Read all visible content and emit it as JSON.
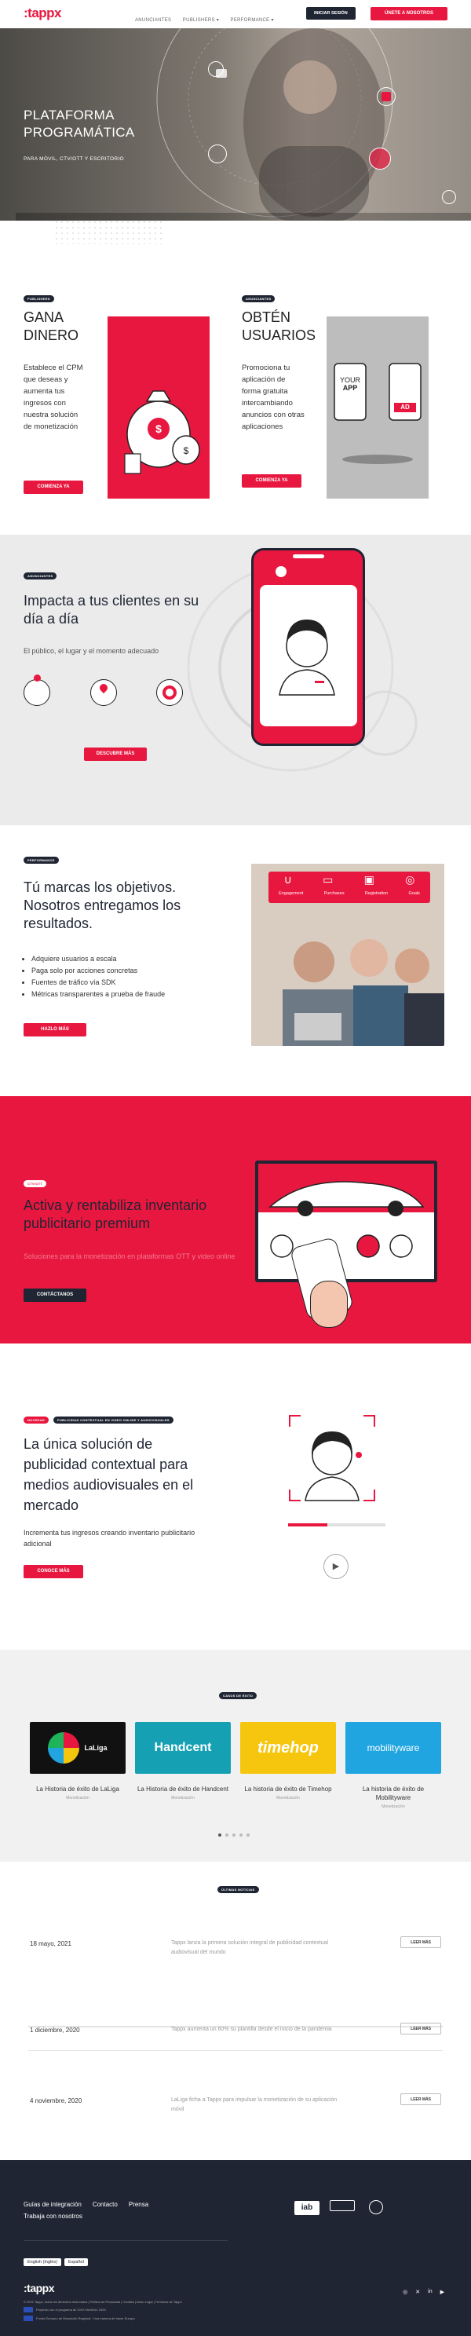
{
  "header": {
    "logo": ":tappx",
    "nav": [
      "ANUNCIANTES",
      "PUBLISHERS ▾",
      "PERFORMANCE ▾"
    ],
    "login": "INICIAR SESIÓN",
    "signup": "ÚNETE A NOSOTROS"
  },
  "hero": {
    "title": "PLATAFORMA PROGRAMÁTICA",
    "subtitle": "PARA MÓVIL, CTV/OTT Y ESCRITORIO"
  },
  "cards": [
    {
      "tag": "PUBLISHERS",
      "title": "GANA DINERO",
      "text": "Establece el CPM que deseas y aumenta tus ingresos con nuestra solución de monetización",
      "button": "COMIENZA YA"
    },
    {
      "tag": "ANUNCIANTES",
      "title": "OBTÉN USUARIOS",
      "text": "Promociona tu aplicación de forma gratuita intercambiando anuncios con otras aplicaciones",
      "button": "COMIENZA YA",
      "phone_label1": "YOUR",
      "phone_label2": "APP",
      "phone_ad": "AD"
    }
  ],
  "impact": {
    "tag": "ANUNCIANTES",
    "title": "Impacta a tus clientes en su día a día",
    "subtitle": "El público, el lugar y el momento adecuado",
    "button": "DESCUBRE MÁS"
  },
  "marks": {
    "tag": "PERFORMANCE",
    "title": "Tú marcas los objetivos. Nosotros entregamos los resultados.",
    "bullets": [
      "Adquiere usuarios a escala",
      "Paga solo por acciones concretas",
      "Fuentes de tráfico vía SDK",
      "Métricas transparentes a prueba de fraude"
    ],
    "button": "HAZLO MÁS",
    "icons": [
      "Engagement",
      "Purchases",
      "Registration",
      "Goals"
    ]
  },
  "ctv": {
    "tag": "CTV/OTT",
    "title": "Activa y rentabiliza inventario publicitario premium",
    "subtitle": "Soluciones para la monetización en plataformas OTT y video online",
    "button": "CONTÁCTANOS"
  },
  "context": {
    "tags": [
      "NOVEDAD",
      "PUBLICIDAD CONTEXTUAL EN VIDEO ONLINE Y AUDIOVISUALES"
    ],
    "title": "La única solución de publicidad contextual para medios audiovisuales en el mercado",
    "subtitle": "Incrementa tus ingresos creando inventario publicitario adicional",
    "button": "CONOCE MÁS"
  },
  "cases": {
    "tag": "CASOS DE ÉXITO",
    "items": [
      {
        "brand": "LaLiga",
        "title": "La Historia de éxito de LaLiga",
        "sub": "Monetización",
        "bg": "#111111"
      },
      {
        "brand": "Handcent",
        "title": "La Historia de éxito de Handcent",
        "sub": "Monetización",
        "bg": "#16a0b4"
      },
      {
        "brand": "timehop",
        "title": "La historia de éxito de Timehop",
        "sub": "Monetización",
        "bg": "#f6c60f"
      },
      {
        "brand": "mobilityware",
        "title": "La historia de éxito de Mobilityware",
        "sub": "Monetización",
        "bg": "#21a5e0"
      }
    ]
  },
  "news": {
    "tag": "ÚLTIMAS NOTICIAS",
    "items": [
      {
        "date": "18 mayo, 2021",
        "text": "Tappx lanza la primera solución integral de publicidad contextual audiovisual del mundo",
        "button": "LEER MÁS"
      },
      {
        "date": "1 diciembre, 2020",
        "text": "Tappx aumenta un 60% su plantilla desde el inicio de la pandemia",
        "button": "LEER MÁS"
      },
      {
        "date": "4 noviembre, 2020",
        "text": "LaLiga ficha a Tappx para impulsar la monetización de su aplicación móvil",
        "button": "LEER MÁS"
      }
    ]
  },
  "footer": {
    "links": [
      "Guías de integración",
      "Contacto",
      "Prensa",
      "Trabaja con nosotros"
    ],
    "langs": [
      "English (Inglés)",
      "Español"
    ],
    "logo": ":tappx",
    "legal": "© 2021 Tappx, todos los derechos reservados | Política de Privacidad | Cookies | Aviso Legal | Términos de Tappx",
    "eu1": "Proyecto con el programa de ICEX NextGen 2020",
    "eu2": "Fondo Europeo de Desarrollo Regional · Una manera de hacer Europa",
    "iab": "iab",
    "social": [
      "◎",
      "✕",
      "in",
      "▶"
    ]
  },
  "colors": {
    "brand": "#e8173f",
    "dark": "#1f2533"
  }
}
